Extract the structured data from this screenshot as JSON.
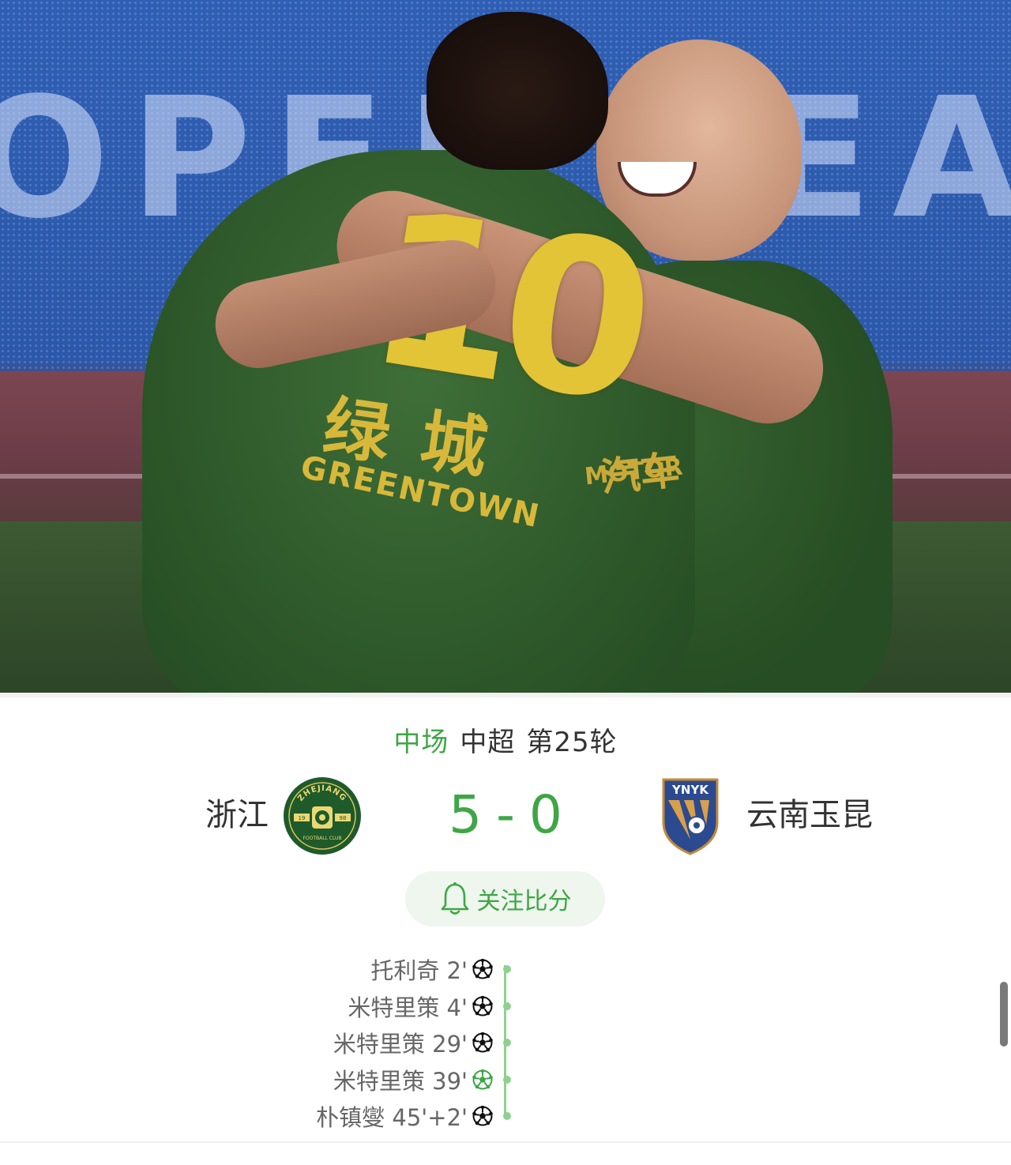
{
  "hero_image": {
    "board_text": "OPER LEAGU",
    "jersey_number": "10",
    "sponsor_cn": "绿城",
    "sponsor_en": "GREENTOWN",
    "sponsor2_cn": "汽车",
    "sponsor2_en": "MOTOR"
  },
  "match": {
    "status": "中场",
    "league": "中超",
    "round": "第25轮",
    "home": {
      "name": "浙江",
      "logo_text_top": "ZHEJIANG",
      "logo_text_bottom": "FOOTBALL CLUB",
      "logo_year_left": "19",
      "logo_year_right": "98",
      "color": "#1f5a2a"
    },
    "away": {
      "name": "云南玉昆",
      "logo_text": "YNYK",
      "color": "#2c4a8f"
    },
    "score_home": "5",
    "score_separator": "-",
    "score_away": "0",
    "accent_color": "#3ea645"
  },
  "follow_button": {
    "label": "关注比分",
    "icon": "bell-icon"
  },
  "goals": [
    {
      "player": "托利奇 2'",
      "icon": "soccer-ball-icon",
      "penalty": false
    },
    {
      "player": "米特里策 4'",
      "icon": "soccer-ball-icon",
      "penalty": false
    },
    {
      "player": "米特里策 29'",
      "icon": "soccer-ball-icon",
      "penalty": false
    },
    {
      "player": "米特里策 39'",
      "icon": "soccer-ball-penalty-icon",
      "penalty": true
    },
    {
      "player": "朴镇燮 45'+2'",
      "icon": "soccer-ball-icon",
      "penalty": false
    }
  ]
}
